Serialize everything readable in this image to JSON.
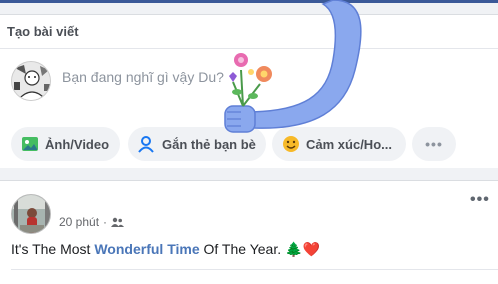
{
  "colors": {
    "accent": "#4a76b8",
    "card": "#ffffff",
    "background": "#f0f2f5",
    "sticker_arm": "#8aa8ee"
  },
  "create_post": {
    "title": "Tạo bài viết",
    "composer_placeholder": "Bạn đang nghĩ gì vậy Du?",
    "actions": [
      {
        "label": "Ảnh/Video",
        "icon": "photo-icon"
      },
      {
        "label": "Gắn thẻ bạn bè",
        "icon": "tag-friends-icon"
      },
      {
        "label": "Cảm xúc/Ho...",
        "icon": "feeling-icon"
      }
    ],
    "more_label": "•••"
  },
  "post": {
    "time": "20 phút",
    "separator": "·",
    "audience_icon": "friends-icon",
    "more_label": "•••",
    "text_before": "It's The Most ",
    "text_highlight": "Wonderful Time",
    "text_after": " Of The Year. ",
    "emoji_tree": "🌲",
    "emoji_heart": "❤️"
  }
}
